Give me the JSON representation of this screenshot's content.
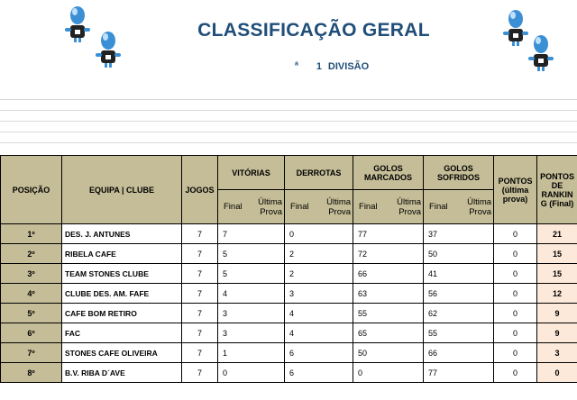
{
  "header": {
    "title": "CLASSIFICAÇÃO GERAL",
    "division_num": "1",
    "division_sup": "a",
    "division_label": "DIVISÃO"
  },
  "table": {
    "headers": {
      "posicao": "POSIÇÃO",
      "equipa": "EQUIPA | CLUBE",
      "jogos": "JOGOS",
      "vitorias": "VITÓRIAS",
      "derrotas": "DERROTAS",
      "golos_marcados": "GOLOS MARCADOS",
      "golos_sofridos": "GOLOS SOFRIDOS",
      "pontos": "PONTOS (última prova)",
      "pontos_ranking": "PONTOS DE RANKIN G (Final)",
      "final": "Final",
      "ultima_prova": "Última Prova"
    },
    "rows": [
      {
        "pos": "1º",
        "club": "DES. J. ANTUNES",
        "jogos": "7",
        "vit": "7",
        "der": "0",
        "gm": "77",
        "gs": "37",
        "pts": "0",
        "rank": "21"
      },
      {
        "pos": "2º",
        "club": "RIBELA CAFE",
        "jogos": "7",
        "vit": "5",
        "der": "2",
        "gm": "72",
        "gs": "50",
        "pts": "0",
        "rank": "15"
      },
      {
        "pos": "3º",
        "club": "TEAM STONES CLUBE",
        "jogos": "7",
        "vit": "5",
        "der": "2",
        "gm": "66",
        "gs": "41",
        "pts": "0",
        "rank": "15"
      },
      {
        "pos": "4º",
        "club": "CLUBE DES. AM. FAFE",
        "jogos": "7",
        "vit": "4",
        "der": "3",
        "gm": "63",
        "gs": "56",
        "pts": "0",
        "rank": "12"
      },
      {
        "pos": "5º",
        "club": "CAFE BOM RETIRO",
        "jogos": "7",
        "vit": "3",
        "der": "4",
        "gm": "55",
        "gs": "62",
        "pts": "0",
        "rank": "9"
      },
      {
        "pos": "6º",
        "club": "FAC",
        "jogos": "7",
        "vit": "3",
        "der": "4",
        "gm": "65",
        "gs": "55",
        "pts": "0",
        "rank": "9"
      },
      {
        "pos": "7º",
        "club": "STONES CAFE OLIVEIRA",
        "jogos": "7",
        "vit": "1",
        "der": "6",
        "gm": "50",
        "gs": "66",
        "pts": "0",
        "rank": "3"
      },
      {
        "pos": "8º",
        "club": "B.V. RIBA D´AVE",
        "jogos": "7",
        "vit": "0",
        "der": "6",
        "gm": "0",
        "gs": "77",
        "pts": "0",
        "rank": "0"
      }
    ]
  },
  "colors": {
    "header_bg": "#c4bd97",
    "ranking_bg": "#fde9d9",
    "title_color": "#1f4e79",
    "figure_blue": "#3b8fd4"
  },
  "icons": [
    "player-figure-icon"
  ]
}
